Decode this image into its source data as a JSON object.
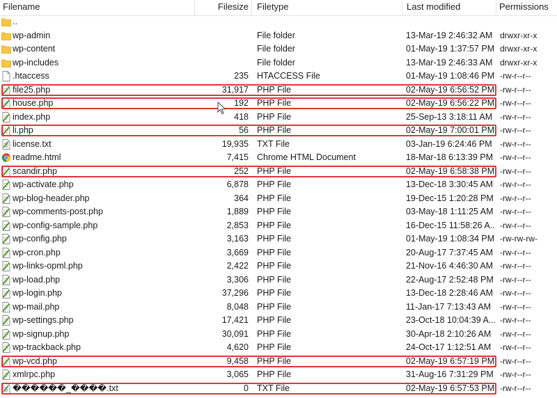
{
  "header": {
    "filename": "Filename",
    "filesize": "Filesize",
    "filetype": "Filetype",
    "modified": "Last modified",
    "permissions": "Permissions"
  },
  "colors": {
    "highlight": "#e0343c",
    "folder": "#f7c744",
    "php_icon": "#5aa02c"
  },
  "rows": [
    {
      "name": "..",
      "size": "",
      "type": "",
      "modified": "",
      "perm": "",
      "icon": "folder-icon",
      "hl": false
    },
    {
      "name": "wp-admin",
      "size": "",
      "type": "File folder",
      "modified": "13-Mar-19 2:46:32 AM",
      "perm": "drwxr-xr-x",
      "icon": "folder-icon",
      "hl": false
    },
    {
      "name": "wp-content",
      "size": "",
      "type": "File folder",
      "modified": "01-May-19 1:37:57 PM",
      "perm": "drwxr-xr-x",
      "icon": "folder-icon",
      "hl": false
    },
    {
      "name": "wp-includes",
      "size": "",
      "type": "File folder",
      "modified": "13-Mar-19 2:46:33 AM",
      "perm": "drwxr-xr-x",
      "icon": "folder-icon",
      "hl": false
    },
    {
      "name": ".htaccess",
      "size": "235",
      "type": "HTACCESS File",
      "modified": "01-May-19 1:08:46 PM",
      "perm": "-rw-r--r--",
      "icon": "blank-file-icon",
      "hl": false
    },
    {
      "name": "file25.php",
      "size": "31,917",
      "type": "PHP File",
      "modified": "02-May-19 6:56:52 PM",
      "perm": "-rw-r--r--",
      "icon": "php-file-icon",
      "hl": true
    },
    {
      "name": "house.php",
      "size": "192",
      "type": "PHP File",
      "modified": "02-May-19 6:56:22 PM",
      "perm": "-rw-r--r--",
      "icon": "php-file-icon",
      "hl": true
    },
    {
      "name": "index.php",
      "size": "418",
      "type": "PHP File",
      "modified": "25-Sep-13 3:18:11 AM",
      "perm": "-rw-r--r--",
      "icon": "php-file-icon",
      "hl": false
    },
    {
      "name": "li.php",
      "size": "56",
      "type": "PHP File",
      "modified": "02-May-19 7:00:01 PM",
      "perm": "-rw-r--r--",
      "icon": "php-file-icon",
      "hl": true
    },
    {
      "name": "license.txt",
      "size": "19,935",
      "type": "TXT File",
      "modified": "03-Jan-19 6:24:46 PM",
      "perm": "-rw-r--r--",
      "icon": "txt-file-icon",
      "hl": false
    },
    {
      "name": "readme.html",
      "size": "7,415",
      "type": "Chrome HTML Document",
      "modified": "18-Mar-18 6:13:39 PM",
      "perm": "-rw-r--r--",
      "icon": "chrome-icon",
      "hl": false
    },
    {
      "name": "scandir.php",
      "size": "252",
      "type": "PHP File",
      "modified": "02-May-19 6:58:38 PM",
      "perm": "-rw-r--r--",
      "icon": "php-file-icon",
      "hl": true
    },
    {
      "name": "wp-activate.php",
      "size": "6,878",
      "type": "PHP File",
      "modified": "13-Dec-18 3:30:45 AM",
      "perm": "-rw-r--r--",
      "icon": "php-file-icon",
      "hl": false
    },
    {
      "name": "wp-blog-header.php",
      "size": "364",
      "type": "PHP File",
      "modified": "19-Dec-15 1:20:28 PM",
      "perm": "-rw-r--r--",
      "icon": "php-file-icon",
      "hl": false
    },
    {
      "name": "wp-comments-post.php",
      "size": "1,889",
      "type": "PHP File",
      "modified": "03-May-18 1:11:25 AM",
      "perm": "-rw-r--r--",
      "icon": "php-file-icon",
      "hl": false
    },
    {
      "name": "wp-config-sample.php",
      "size": "2,853",
      "type": "PHP File",
      "modified": "16-Dec-15 11:58:26 A...",
      "perm": "-rw-r--r--",
      "icon": "php-file-icon",
      "hl": false
    },
    {
      "name": "wp-config.php",
      "size": "3,163",
      "type": "PHP File",
      "modified": "01-May-19 1:08:34 PM",
      "perm": "-rw-rw-rw-",
      "icon": "php-file-icon",
      "hl": false
    },
    {
      "name": "wp-cron.php",
      "size": "3,669",
      "type": "PHP File",
      "modified": "20-Aug-17 7:37:45 AM",
      "perm": "-rw-r--r--",
      "icon": "php-file-icon",
      "hl": false
    },
    {
      "name": "wp-links-opml.php",
      "size": "2,422",
      "type": "PHP File",
      "modified": "21-Nov-16 4:46:30 AM",
      "perm": "-rw-r--r--",
      "icon": "php-file-icon",
      "hl": false
    },
    {
      "name": "wp-load.php",
      "size": "3,306",
      "type": "PHP File",
      "modified": "22-Aug-17 2:52:48 PM",
      "perm": "-rw-r--r--",
      "icon": "php-file-icon",
      "hl": false
    },
    {
      "name": "wp-login.php",
      "size": "37,296",
      "type": "PHP File",
      "modified": "13-Dec-18 2:28:46 AM",
      "perm": "-rw-r--r--",
      "icon": "php-file-icon",
      "hl": false
    },
    {
      "name": "wp-mail.php",
      "size": "8,048",
      "type": "PHP File",
      "modified": "11-Jan-17 7:13:43 AM",
      "perm": "-rw-r--r--",
      "icon": "php-file-icon",
      "hl": false
    },
    {
      "name": "wp-settings.php",
      "size": "17,421",
      "type": "PHP File",
      "modified": "23-Oct-18 10:04:39 A...",
      "perm": "-rw-r--r--",
      "icon": "php-file-icon",
      "hl": false
    },
    {
      "name": "wp-signup.php",
      "size": "30,091",
      "type": "PHP File",
      "modified": "30-Apr-18 2:10:26 AM",
      "perm": "-rw-r--r--",
      "icon": "php-file-icon",
      "hl": false
    },
    {
      "name": "wp-trackback.php",
      "size": "4,620",
      "type": "PHP File",
      "modified": "24-Oct-17 1:12:51 AM",
      "perm": "-rw-r--r--",
      "icon": "php-file-icon",
      "hl": false
    },
    {
      "name": "wp-vcd.php",
      "size": "9,458",
      "type": "PHP File",
      "modified": "02-May-19 6:57:19 PM",
      "perm": "-rw-r--r--",
      "icon": "php-file-icon",
      "hl": true
    },
    {
      "name": "xmlrpc.php",
      "size": "3,065",
      "type": "PHP File",
      "modified": "31-Aug-16 7:31:29 PM",
      "perm": "-rw-r--r--",
      "icon": "php-file-icon",
      "hl": false
    },
    {
      "name": "������_����.txt",
      "size": "0",
      "type": "TXT File",
      "modified": "02-May-19 6:57:53 PM",
      "perm": "-rw-r--r--",
      "icon": "txt-file-icon",
      "hl": true
    }
  ]
}
